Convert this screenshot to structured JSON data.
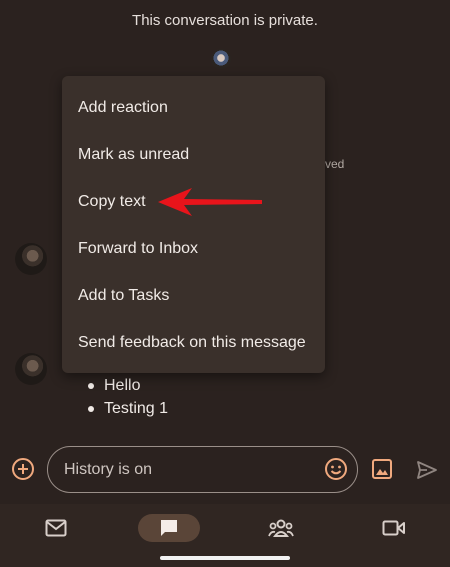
{
  "conversation": {
    "privacy_notice": "This conversation is private.",
    "partial_status": "ved",
    "bullets": [
      "Hello",
      "Testing 1"
    ]
  },
  "context_menu": {
    "items": [
      "Add reaction",
      "Mark as unread",
      "Copy text",
      "Forward to Inbox",
      "Add to Tasks",
      "Send feedback on this message"
    ],
    "highlighted_item": "Copy text",
    "annotation_color": "#e8141b"
  },
  "composer": {
    "placeholder": "History is on",
    "accent": "#f0a97e"
  },
  "icons": {
    "add": "add-circle-icon",
    "emoji": "emoji-icon",
    "image": "image-icon",
    "send": "send-icon",
    "mail": "mail-icon",
    "chat": "chat-icon",
    "spaces": "spaces-icon",
    "meet": "video-camera-icon"
  },
  "bottom_nav": {
    "active_tab": "chat"
  },
  "colors": {
    "background": "#2b221f",
    "menu_background": "#3a302b",
    "nav_background": "#302622",
    "active_pill": "#5a4538"
  }
}
